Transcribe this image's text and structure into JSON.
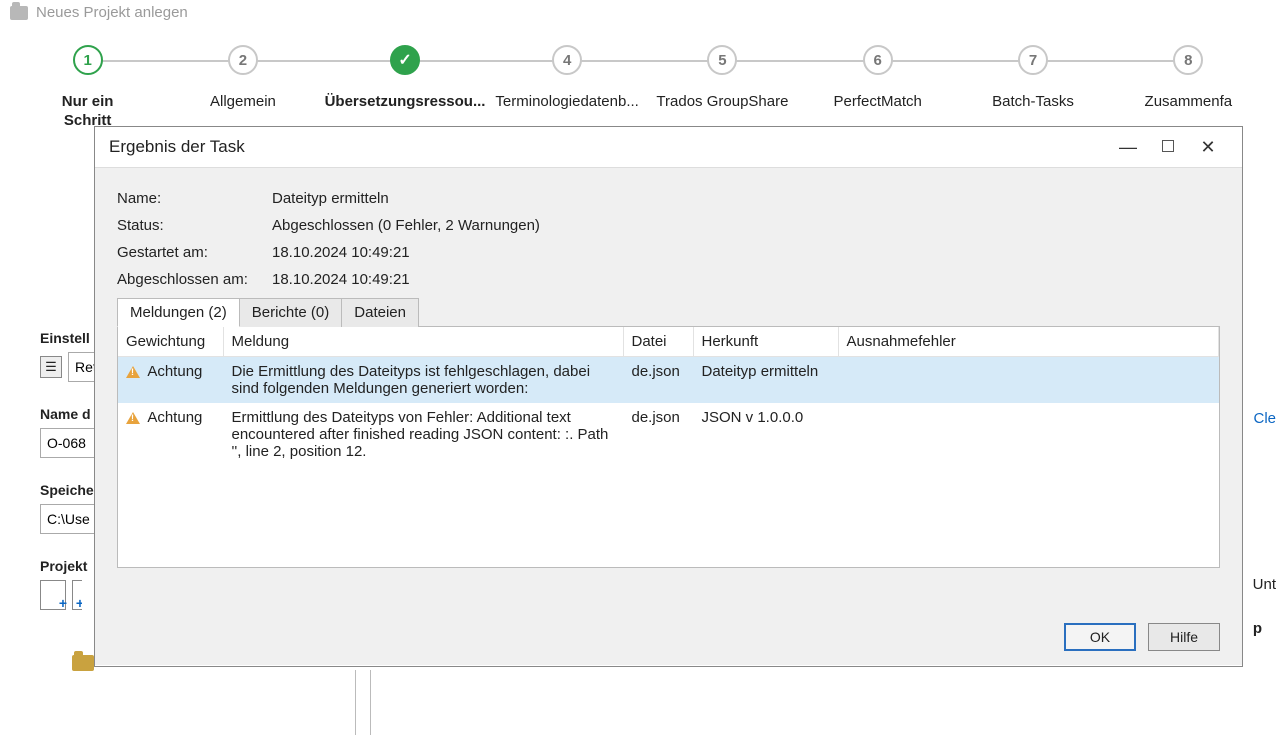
{
  "window": {
    "title": "Neues Projekt anlegen"
  },
  "steps": [
    {
      "num": "1",
      "label": "Nur ein\nSchritt",
      "state": "current"
    },
    {
      "num": "2",
      "label": "Allgemein",
      "state": "inactive"
    },
    {
      "num": "3",
      "label": "Übersetzungsressou...",
      "state": "done"
    },
    {
      "num": "4",
      "label": "Terminologiedatenb...",
      "state": "inactive"
    },
    {
      "num": "5",
      "label": "Trados GroupShare",
      "state": "inactive"
    },
    {
      "num": "6",
      "label": "PerfectMatch",
      "state": "inactive"
    },
    {
      "num": "7",
      "label": "Batch-Tasks",
      "state": "inactive"
    },
    {
      "num": "8",
      "label": "Zusammenfa",
      "state": "inactive"
    }
  ],
  "form": {
    "einstellungen_label": "Einstell",
    "einstellungen_value": "Ret",
    "name_label": "Name d",
    "name_value": "O-068",
    "speicher_label": "Speiche",
    "speicher_value": "C:\\Use",
    "projekt_label": "Projekt",
    "clear_link": "Cle",
    "unt_label": "Unt",
    "p_label": "p"
  },
  "dialog": {
    "title": "Ergebnis der Task",
    "props": {
      "name_label": "Name:",
      "name_value": "Dateityp ermitteln",
      "status_label": "Status:",
      "status_value": "Abgeschlossen (0 Fehler, 2 Warnungen)",
      "start_label": "Gestartet am:",
      "start_value": "18.10.2024 10:49:21",
      "end_label": "Abgeschlossen am:",
      "end_value": "18.10.2024 10:49:21"
    },
    "tabs": {
      "messages": "Meldungen (2)",
      "reports": "Berichte (0)",
      "files": "Dateien"
    },
    "columns": {
      "weight": "Gewichtung",
      "message": "Meldung",
      "file": "Datei",
      "origin": "Herkunft",
      "exception": "Ausnahmefehler"
    },
    "rows": [
      {
        "weight": "Achtung",
        "message": "Die Ermittlung des Dateityps ist fehlgeschlagen, dabei sind folgenden Meldungen generiert worden:",
        "file": "de.json",
        "origin": "Dateityp ermitteln",
        "exception": "",
        "selected": true
      },
      {
        "weight": "Achtung",
        "message": "Ermittlung des Dateityps von Fehler: Additional text encountered after finished reading JSON content: :. Path '', line 2, position 12.",
        "file": "de.json",
        "origin": "JSON v 1.0.0.0",
        "exception": "",
        "selected": false
      }
    ],
    "buttons": {
      "ok": "OK",
      "help": "Hilfe"
    }
  }
}
